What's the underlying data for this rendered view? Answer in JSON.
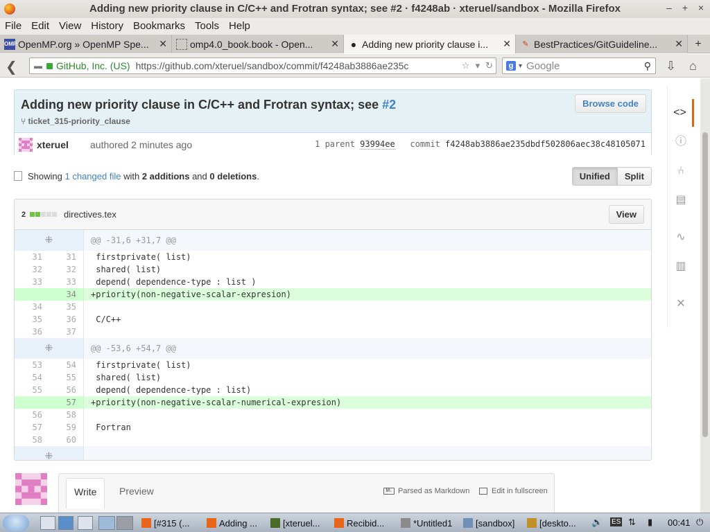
{
  "window": {
    "title": "Adding new priority clause in C/C++ and Frotran syntax; see #2 · f4248ab · xteruel/sandbox - Mozilla Firefox",
    "controls": [
      "–",
      "+",
      "×"
    ]
  },
  "menu": [
    "File",
    "Edit",
    "View",
    "History",
    "Bookmarks",
    "Tools",
    "Help"
  ],
  "tabs": [
    {
      "label": "OpenMP.org » OpenMP Spe...",
      "icon": "omp-icon",
      "glyph": "OMP",
      "active": false
    },
    {
      "label": "omp4.0_book.book - Open...",
      "icon": "page-icon",
      "glyph": "",
      "active": false
    },
    {
      "label": "Adding new priority clause i...",
      "icon": "github-icon",
      "glyph": "●",
      "active": true
    },
    {
      "label": "BestPractices/GitGuideline...",
      "icon": "wiki-icon",
      "glyph": "✎",
      "active": false
    }
  ],
  "newtab": "+",
  "nav": {
    "identity": "GitHub, Inc. (US)",
    "url": "https://github.com/xteruel/sandbox/commit/f4248ab3886ae235c",
    "search_placeholder": "Google",
    "search_engine_glyph": "g"
  },
  "commit": {
    "title": "Adding new priority clause in C/C++ and Frotran syntax; see",
    "issue": "#2",
    "branch": "ticket_315-priority_clause",
    "browse_label": "Browse code",
    "author": "xteruel",
    "authored": "authored 2 minutes ago",
    "parent_label": "1 parent",
    "parent_sha": "93994ee",
    "commit_label": "commit",
    "commit_sha": "f4248ab3886ae235dbdf502806aec38c48105071"
  },
  "toc": {
    "showing": "Showing",
    "changed": "1 changed file",
    "with": "with",
    "additions": "2 additions",
    "and": "and",
    "deletions": "0 deletions",
    "period": ".",
    "unified": "Unified",
    "split": "Split"
  },
  "file": {
    "count": "2",
    "diffstat": [
      "add",
      "add",
      "neutral",
      "neutral",
      "neutral"
    ],
    "name": "directives.tex",
    "view_label": "View"
  },
  "colors": {
    "diffstat_add": "#6cc644",
    "diffstat_neutral": "#dddddd",
    "link": "#4183c4",
    "add_bg": "#dbffdb",
    "rail_active": "#d26911"
  },
  "hunks": [
    {
      "header": "@@ -31,6 +31,7 @@",
      "lines": [
        {
          "old": "31",
          "new": "31",
          "type": "ctx",
          "code": " firstprivate( list)"
        },
        {
          "old": "32",
          "new": "32",
          "type": "ctx",
          "code": " shared( list)"
        },
        {
          "old": "33",
          "new": "33",
          "type": "ctx",
          "code": " depend( dependence-type : list )"
        },
        {
          "old": "",
          "new": "34",
          "type": "add",
          "code": "+priority(non-negative-scalar-expresion)"
        },
        {
          "old": "34",
          "new": "35",
          "type": "ctx",
          "code": ""
        },
        {
          "old": "35",
          "new": "36",
          "type": "ctx",
          "code": " C/C++"
        },
        {
          "old": "36",
          "new": "37",
          "type": "ctx",
          "code": ""
        }
      ]
    },
    {
      "header": "@@ -53,6 +54,7 @@",
      "lines": [
        {
          "old": "53",
          "new": "54",
          "type": "ctx",
          "code": " firstprivate( list)"
        },
        {
          "old": "54",
          "new": "55",
          "type": "ctx",
          "code": " shared( list)"
        },
        {
          "old": "55",
          "new": "56",
          "type": "ctx",
          "code": " depend( dependence-type : list)"
        },
        {
          "old": "",
          "new": "57",
          "type": "add",
          "code": "+priority(non-negative-scalar-numerical-expresion)"
        },
        {
          "old": "56",
          "new": "58",
          "type": "ctx",
          "code": ""
        },
        {
          "old": "57",
          "new": "59",
          "type": "ctx",
          "code": " Fortran"
        },
        {
          "old": "58",
          "new": "60",
          "type": "ctx",
          "code": ""
        }
      ]
    }
  ],
  "comment": {
    "write": "Write",
    "preview": "Preview",
    "markdown_hint": "Parsed as Markdown",
    "markdown_glyph": "M↓",
    "fullscreen": "Edit in fullscreen"
  },
  "rail": [
    {
      "name": "code-icon",
      "glyph": "<>",
      "active": true
    },
    {
      "name": "issues-icon",
      "glyph": "ⓘ",
      "active": false
    },
    {
      "name": "pull-requests-icon",
      "glyph": "⑃",
      "active": false
    },
    {
      "name": "wiki-icon",
      "glyph": "▤",
      "active": false
    },
    {
      "name": "pulse-icon",
      "glyph": "∿",
      "active": false
    },
    {
      "name": "graphs-icon",
      "glyph": "▥",
      "active": false
    },
    {
      "name": "settings-icon",
      "glyph": "✕",
      "active": false
    }
  ],
  "taskbar": {
    "tasks": [
      {
        "label": "[#315 (...",
        "color": "#e8661a"
      },
      {
        "label": "Adding ...",
        "color": "#e8661a"
      },
      {
        "label": "[xteruel...",
        "color": "#4a6a2a"
      },
      {
        "label": "Recibid...",
        "color": "#e8661a"
      },
      {
        "label": "*Untitled1",
        "color": "#8a8a8a"
      },
      {
        "label": "[sandbox]",
        "color": "#6f8fb5"
      },
      {
        "label": "[deskto...",
        "color": "#c0902a"
      }
    ],
    "keyboard": "ES",
    "clock": "00:41"
  }
}
